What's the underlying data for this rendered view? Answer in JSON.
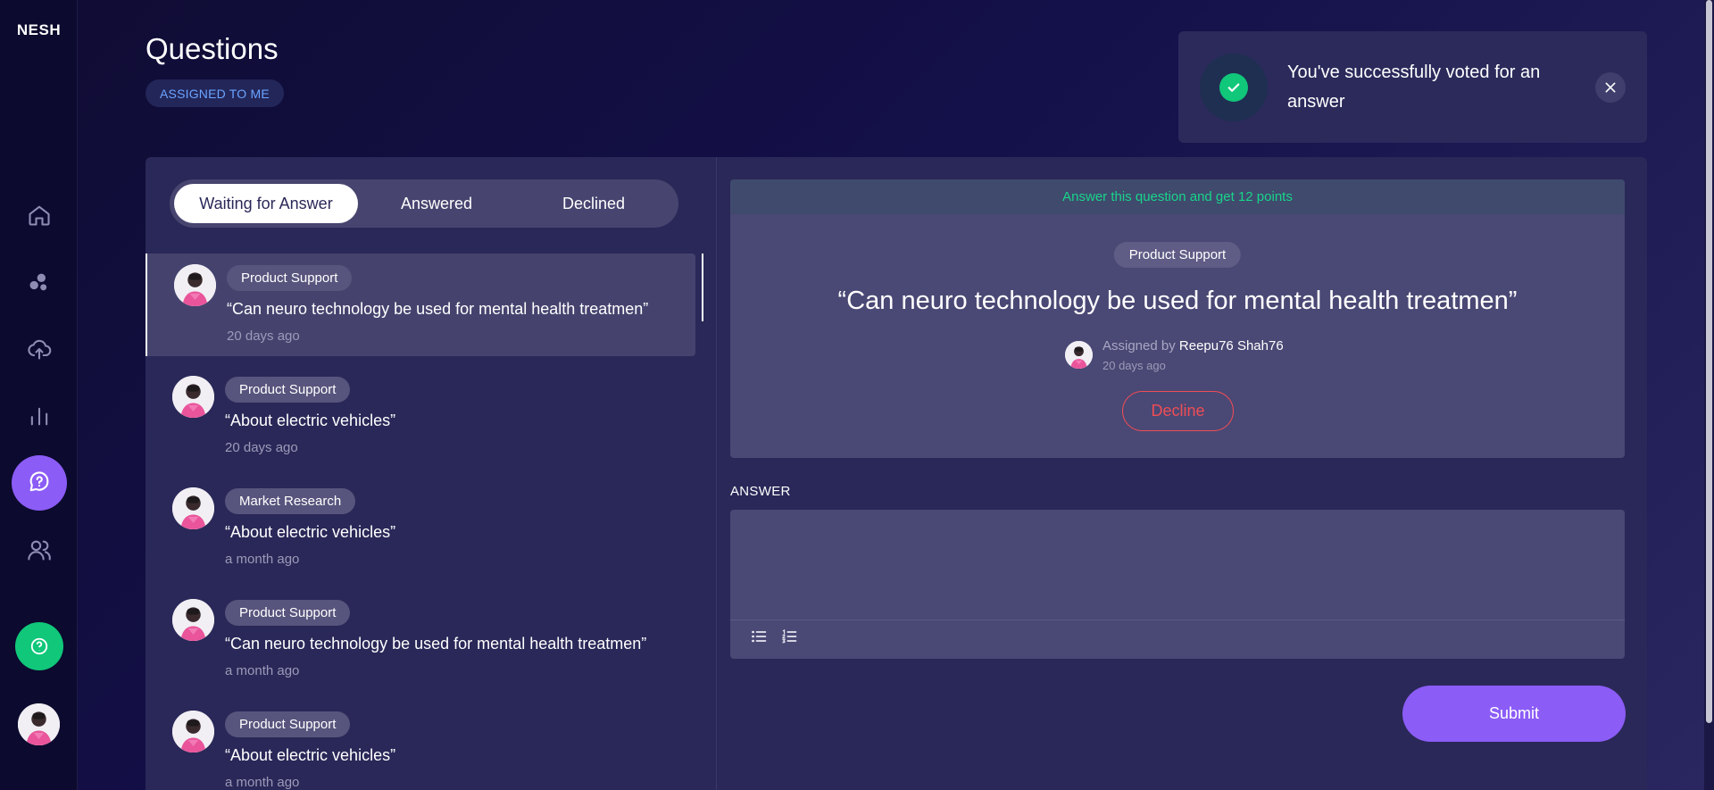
{
  "app": {
    "logo": "NESH"
  },
  "sidebar": {
    "items": [
      {
        "name": "home",
        "icon": "home-icon"
      },
      {
        "name": "circles",
        "icon": "bubbles-icon"
      },
      {
        "name": "upload",
        "icon": "cloud-upload-icon"
      },
      {
        "name": "analytics",
        "icon": "bar-chart-icon"
      },
      {
        "name": "questions",
        "icon": "chat-question-icon",
        "active": true
      },
      {
        "name": "users",
        "icon": "users-icon"
      }
    ],
    "help_icon": "question-circle-icon"
  },
  "header": {
    "title": "Questions",
    "filter_badge": "ASSIGNED TO ME"
  },
  "toast": {
    "message": "You've successfully voted for an answer",
    "icon": "check-circle-icon",
    "close_icon": "close-icon"
  },
  "tabs": [
    {
      "label": "Waiting for Answer",
      "active": true
    },
    {
      "label": "Answered"
    },
    {
      "label": "Declined"
    }
  ],
  "questions": [
    {
      "tag": "Product Support",
      "title": "“Can neuro technology be used for mental health treatmen”",
      "time": "20 days ago",
      "selected": true
    },
    {
      "tag": "Product Support",
      "title": "“About electric vehicles”",
      "time": "20 days ago"
    },
    {
      "tag": "Market Research",
      "title": "“About electric vehicles”",
      "time": "a month ago"
    },
    {
      "tag": "Product Support",
      "title": "“Can neuro technology be used for mental health treatmen”",
      "time": "a month ago"
    },
    {
      "tag": "Product Support",
      "title": "“About electric vehicles”",
      "time": "a month ago"
    }
  ],
  "detail": {
    "points_text": "Answer this question and get 12 points",
    "tag": "Product Support",
    "title": "“Can neuro technology be used for mental health treatmen”",
    "assigned_prefix": "Assigned by",
    "assigned_name": "Reepu76 Shah76",
    "time": "20 days ago",
    "decline_label": "Decline"
  },
  "answer": {
    "label": "ANSWER",
    "value": "",
    "tools": [
      "bullet-list-icon",
      "numbered-list-icon"
    ],
    "submit_label": "Submit"
  },
  "colors": {
    "accent": "#8b5cf6",
    "success": "#10c77a",
    "danger": "#ef4d56",
    "link": "#6aa4ff"
  }
}
